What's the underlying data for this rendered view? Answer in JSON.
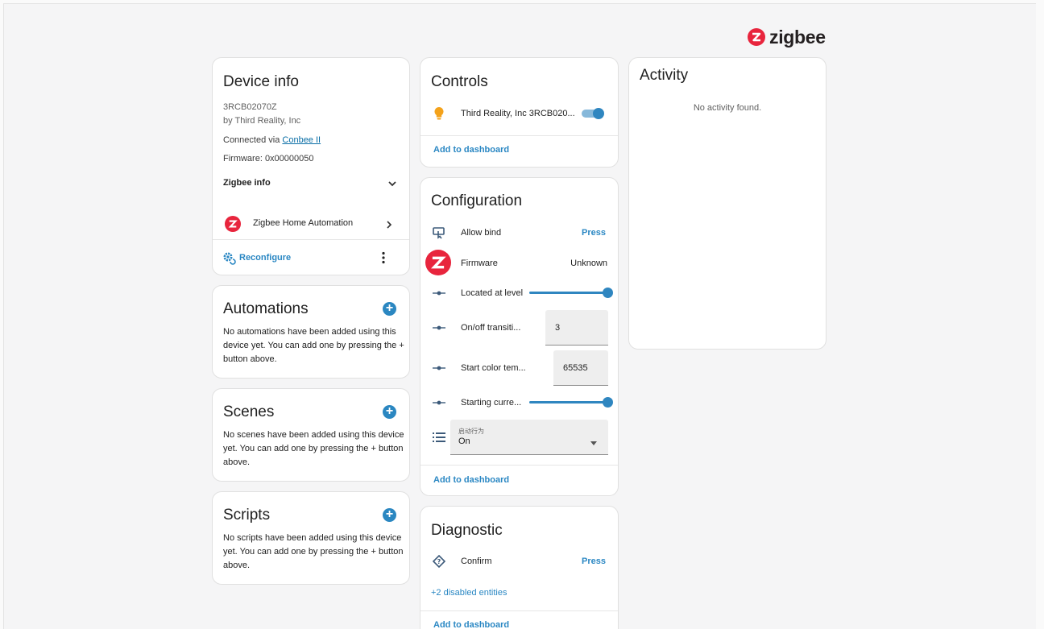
{
  "brand": {
    "logo_text": "zigbee",
    "accent": "#e8253d"
  },
  "device_info": {
    "title": "Device info",
    "model": "3RCB02070Z",
    "manufacturer": "by Third Reality, Inc",
    "connected_prefix": "Connected via ",
    "connected_link": "Conbee II",
    "firmware": "Firmware: 0x00000050",
    "zigbee_info_label": "Zigbee info",
    "integration_label": "Zigbee Home Automation",
    "reconfigure_label": "Reconfigure"
  },
  "automations": {
    "title": "Automations",
    "text": "No automations have been added using this device yet. You can add one by pressing the + button above."
  },
  "scenes": {
    "title": "Scenes",
    "text": "No scenes have been added using this device yet. You can add one by pressing the + button above."
  },
  "scripts": {
    "title": "Scripts",
    "text": "No scripts have been added using this device yet. You can add one by pressing the + button above."
  },
  "controls": {
    "title": "Controls",
    "light_label": "Third Reality, Inc 3RCB020...",
    "light_on": true,
    "add_to_dashboard": "Add to dashboard"
  },
  "configuration": {
    "title": "Configuration",
    "allow_bind_label": "Allow bind",
    "allow_bind_action": "Press",
    "firmware_label": "Firmware",
    "firmware_value": "Unknown",
    "level_label": "Located at level",
    "level_fraction": 1.0,
    "onoff_label": "On/off transiti...",
    "onoff_value": "3",
    "color_temp_label": "Start color tem...",
    "color_temp_value": "65535",
    "starting_label": "Starting curre...",
    "starting_fraction": 1.0,
    "select_label": "启动行为",
    "select_value": "On",
    "add_to_dashboard": "Add to dashboard"
  },
  "diagnostic": {
    "title": "Diagnostic",
    "confirm_label": "Confirm",
    "confirm_action": "Press",
    "disabled_entities": "+2 disabled entities",
    "add_to_dashboard": "Add to dashboard"
  },
  "activity": {
    "title": "Activity",
    "empty_text": "No activity found."
  }
}
